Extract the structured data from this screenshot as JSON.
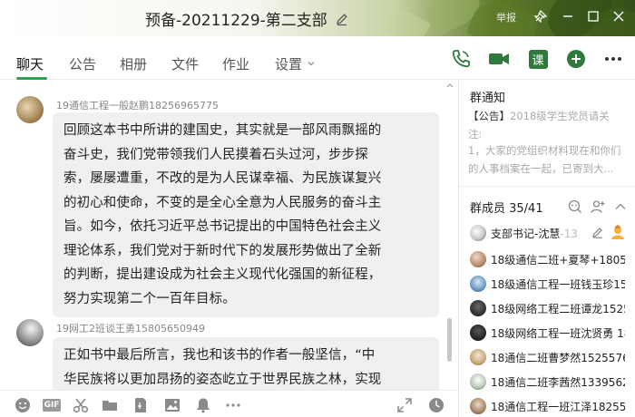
{
  "window": {
    "title": "预备-20211229-第二支部",
    "report_label": "举报"
  },
  "tabs": [
    {
      "label": "聊天"
    },
    {
      "label": "公告"
    },
    {
      "label": "相册"
    },
    {
      "label": "文件"
    },
    {
      "label": "作业"
    },
    {
      "label": "设置"
    }
  ],
  "toolbar": {
    "course_label": "课"
  },
  "messages": [
    {
      "sender": "19通信工程一般赵鹏18256965775",
      "lines": [
        "回顾这本书中所讲的建国史，其实就是一部风雨飘摇的",
        "奋斗史，我们党带领我们人民摸着石头过河，步步探",
        "索，屡屡遭重，不改的是为人民谋幸福、为民族谋复兴",
        "的初心和使命，不变的是全心全意为人民服务的奋斗主",
        "旨。如今，依托习近平总书记提出的中国特色社会主义",
        "理论体系，我们党对于新时代下的发展形势做出了全新",
        "的判断，提出建设成为社会主义现代化强国的新征程，",
        "努力实现第二个一百年目标。"
      ]
    },
    {
      "sender": "19网工2班谈王勇15805650949",
      "lines": [
        "正如书中最后所言，我也和该书的作者一般坚信，“中",
        "华民族将以更加昂扬的姿态屹立于世界民族之林，实现"
      ]
    }
  ],
  "notice": {
    "title": "群通知",
    "tag": "【公告】",
    "headline": "2018级学生党员请关",
    "line2": "注:",
    "line3": "1，大家的党组织材料现在和你们",
    "line4": "的人事档案在一起，已寄到大..."
  },
  "members": {
    "title": "群成员 35/41",
    "list": [
      {
        "name": "支部书记-沈慧",
        "suffix": "-13",
        "is_admin": true
      },
      {
        "name": "18级通信二班+夏琴+18056"
      },
      {
        "name": "18级通信工程一班钱玉珍15"
      },
      {
        "name": "18级网络工程二班谭龙1525"
      },
      {
        "name": "18级网络工程一班沈贤勇 18"
      },
      {
        "name": "18通信二班曹梦然15255768"
      },
      {
        "name": "18通信二班李茜然13395620"
      },
      {
        "name": "18通信工程一班江泽1825554"
      }
    ]
  }
}
